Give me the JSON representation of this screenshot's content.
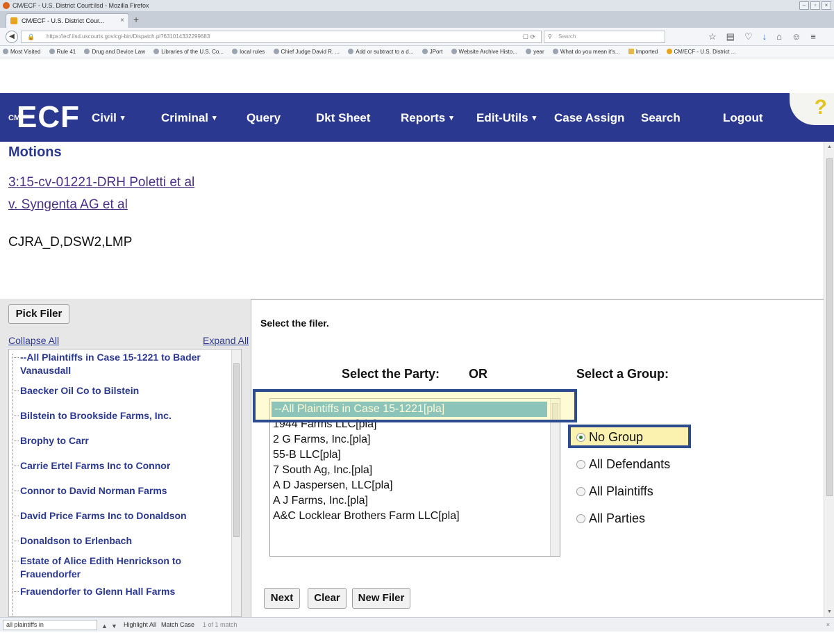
{
  "browser": {
    "window_title": "CM/ECF - U.S. District Court:ilsd - Mozilla Firefox",
    "tab_title": "CM/ECF - U.S. District Cour...",
    "url": "https://ecf.ilsd.uscourts.gov/cgi-bin/Dispatch.pl?631014332299683",
    "search_placeholder": "Search",
    "bookmarks": [
      "Most Visited",
      "Rule 41",
      "Drug and Device Law",
      "Libraries of the U.S. Co...",
      "local rules",
      "Chief Judge David R. ...",
      "Add or subtract to a d...",
      "JPort",
      "Website Archive Histo...",
      "year",
      "What do you mean it's...",
      "Imported",
      "CM/ECF - U.S. District ..."
    ]
  },
  "ecf": {
    "logo": "ECF",
    "logo_prefix": "CM",
    "menu": {
      "civil": "Civil",
      "criminal": "Criminal",
      "query": "Query",
      "dkt_sheet": "Dkt Sheet",
      "reports": "Reports",
      "edit_utils": "Edit-Utils",
      "case_assign": "Case Assign",
      "search": "Search",
      "logout": "Logout"
    },
    "help": "?"
  },
  "page": {
    "title": "Motions",
    "case_line1": "3:15-cv-01221-DRH Poletti et al",
    "case_line2": "v. Syngenta AG et al",
    "flags": "CJRA_D,DSW2,LMP"
  },
  "left_panel": {
    "pick_filer_button": "Pick Filer",
    "collapse_all": "Collapse All",
    "expand_all": "Expand All",
    "tree_items": [
      "--All Plaintiffs in Case 15-1221 to Bader Vanausdall",
      "Baecker Oil Co to Bilstein",
      "Bilstein to Brookside Farms, Inc.",
      "Brophy to Carr",
      "Carrie Ertel Farms Inc to Connor",
      "Connor to David Norman Farms",
      "David Price Farms Inc to Donaldson",
      "Donaldson to Erlenbach",
      "Estate of Alice Edith Henrickson to Frauendorfer",
      "Frauendorfer to Glenn Hall Farms"
    ]
  },
  "form": {
    "instruction": "Select the filer.",
    "party_label": "Select the Party:",
    "or_label": "OR",
    "group_label": "Select a Group:",
    "party_options": [
      "--All Plaintiffs in Case 15-1221[pla]",
      "1944 Farms LLC[pla]",
      "2 G Farms, Inc.[pla]",
      "55-B LLC[pla]",
      "7 South Ag, Inc.[pla]",
      "A D Jaspersen, LLC[pla]",
      "A J Farms, Inc.[pla]",
      "A&C Locklear Brothers Farm LLC[pla]"
    ],
    "groups": [
      "No Group",
      "All Defendants",
      "All Plaintiffs",
      "All Parties"
    ],
    "selected_group": "No Group",
    "buttons": {
      "next": "Next",
      "clear": "Clear",
      "new_filer": "New Filer"
    }
  },
  "find_bar": {
    "query": "all plaintiffs in",
    "highlight_all": "Highlight All",
    "match_case": "Match Case",
    "match_count": "1 of 1 match"
  },
  "colors": {
    "ecf_nav": "#2b3890",
    "selected_option": "#2f9bcf",
    "highlight_border": "#2d4b8f",
    "highlight_fill": "#fbf2b0"
  }
}
